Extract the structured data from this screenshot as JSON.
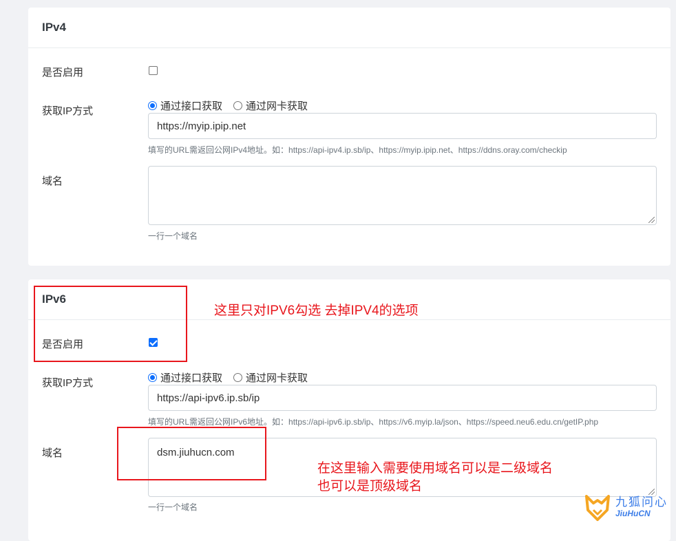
{
  "ipv4": {
    "title": "IPv4",
    "enable_label": "是否启用",
    "enabled": false,
    "method_label": "获取IP方式",
    "method_options": [
      "通过接口获取",
      "通过网卡获取"
    ],
    "method_selected": "通过接口获取",
    "url_value": "https://myip.ipip.net",
    "url_help": "填写的URL需返回公网IPv4地址。如：https://api-ipv4.ip.sb/ip、https://myip.ipip.net、https://ddns.oray.com/checkip",
    "domain_label": "域名",
    "domain_value": "",
    "domain_help": "一行一个域名"
  },
  "ipv6": {
    "title": "IPv6",
    "enable_label": "是否启用",
    "enabled": true,
    "method_label": "获取IP方式",
    "method_options": [
      "通过接口获取",
      "通过网卡获取"
    ],
    "method_selected": "通过接口获取",
    "url_value": "https://api-ipv6.ip.sb/ip",
    "url_help": "填写的URL需返回公网IPv6地址。如：https://api-ipv6.ip.sb/ip、https://v6.myip.la/json、https://speed.neu6.edu.cn/getIP.php",
    "domain_label": "域名",
    "domain_value": "dsm.jiuhucn.com",
    "domain_help": "一行一个域名"
  },
  "annotations": {
    "note_1": "这里只对IPV6勾选 去掉IPV4的选项",
    "note_2_line1": "在这里输入需要使用域名可以是二级域名",
    "note_2_line2": "也可以是顶级域名",
    "highlight_color": "#e8161c"
  },
  "watermark": {
    "text_cn": "九狐问心",
    "text_en": "JiuHuCN",
    "icon": "fox-logo-icon"
  },
  "colors": {
    "primary": "#0d6efd",
    "background": "#f1f2f5"
  }
}
